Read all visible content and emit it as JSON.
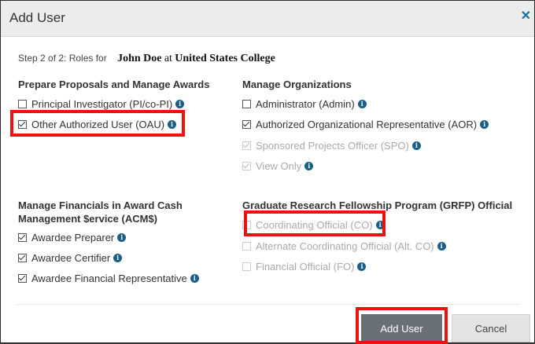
{
  "dialog": {
    "title": "Add User"
  },
  "step": {
    "label": "Step 2 of 2: Roles for",
    "user": "John Doe",
    "at": "at",
    "org": "United States College"
  },
  "sections": {
    "awards": {
      "heading": "Prepare Proposals and Manage Awards",
      "items": [
        {
          "label": "Principal Investigator (PI/co-PI)",
          "checked": false,
          "disabled": false
        },
        {
          "label": "Other Authorized User (OAU)",
          "checked": true,
          "disabled": false
        }
      ]
    },
    "orgs": {
      "heading": "Manage Organizations",
      "items": [
        {
          "label": "Administrator (Admin)",
          "checked": false,
          "disabled": false
        },
        {
          "label": "Authorized Organizational Representative (AOR)",
          "checked": true,
          "disabled": false
        },
        {
          "label": "Sponsored Projects Officer (SPO)",
          "checked": true,
          "disabled": true
        },
        {
          "label": "View Only",
          "checked": true,
          "disabled": true
        }
      ]
    },
    "financials": {
      "heading_line1": "Manage Financials in Award Cash",
      "heading_line2": "Management $ervice (ACM$)",
      "items": [
        {
          "label": "Awardee Preparer",
          "checked": true,
          "disabled": false
        },
        {
          "label": "Awardee Certifier",
          "checked": true,
          "disabled": false
        },
        {
          "label": "Awardee Financial Representative",
          "checked": true,
          "disabled": false
        }
      ]
    },
    "grfp": {
      "heading": "Graduate Research Fellowship Program (GRFP) Official",
      "items": [
        {
          "label": "Coordinating Official (CO)",
          "checked": false,
          "disabled": true
        },
        {
          "label": "Alternate Coordinating Official (Alt. CO)",
          "checked": false,
          "disabled": true
        },
        {
          "label": "Financial Official (FO)",
          "checked": false,
          "disabled": true
        }
      ]
    }
  },
  "footer": {
    "add_label": "Add User",
    "cancel_label": "Cancel"
  },
  "colors": {
    "highlight": "#ee1111",
    "info_icon": "#1b5e87",
    "primary_button": "#6a7077"
  }
}
